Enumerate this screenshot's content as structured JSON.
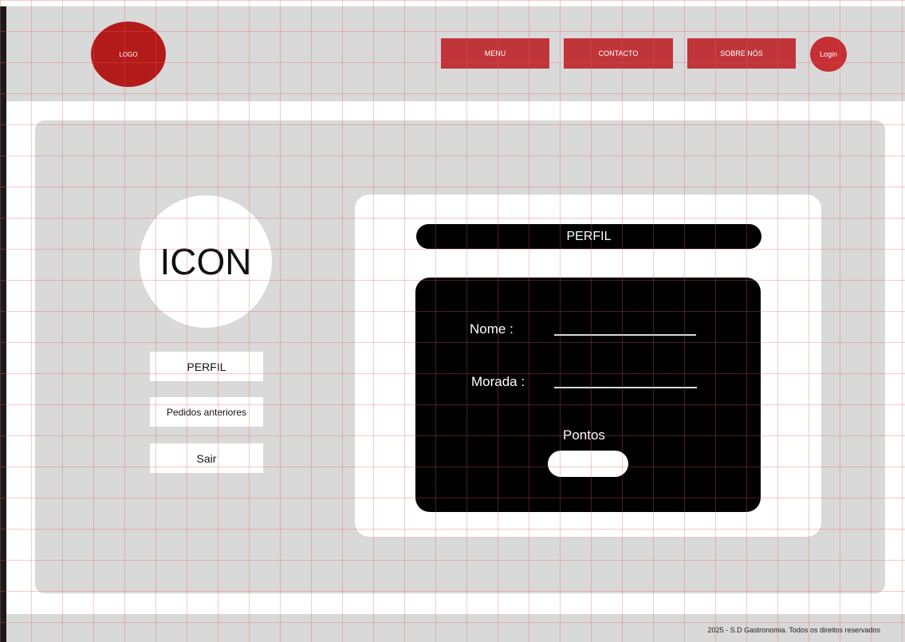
{
  "header": {
    "logo_text": "LOGO",
    "nav": {
      "menu": "MENU",
      "contacto": "CONTACTO",
      "sobre_nos": "SOBRE NÓS"
    },
    "login": "Login"
  },
  "sidebar": {
    "avatar_text": "ICON",
    "items": [
      {
        "label": "PERFIL"
      },
      {
        "label": "Pedidos anteriores"
      },
      {
        "label": "Sair"
      }
    ]
  },
  "profile": {
    "title": "PERFIL",
    "fields": {
      "nome_label": "Nome :",
      "morada_label": "Morada :",
      "pontos_label": "Pontos"
    }
  },
  "footer": {
    "text": "2025 - S.D Gastronomia. Todos os direitos reservados"
  },
  "colors": {
    "brand_red": "#b31b1b",
    "nav_red": "#c0353a",
    "panel_gray": "#d9d9d9",
    "black": "#000000"
  }
}
